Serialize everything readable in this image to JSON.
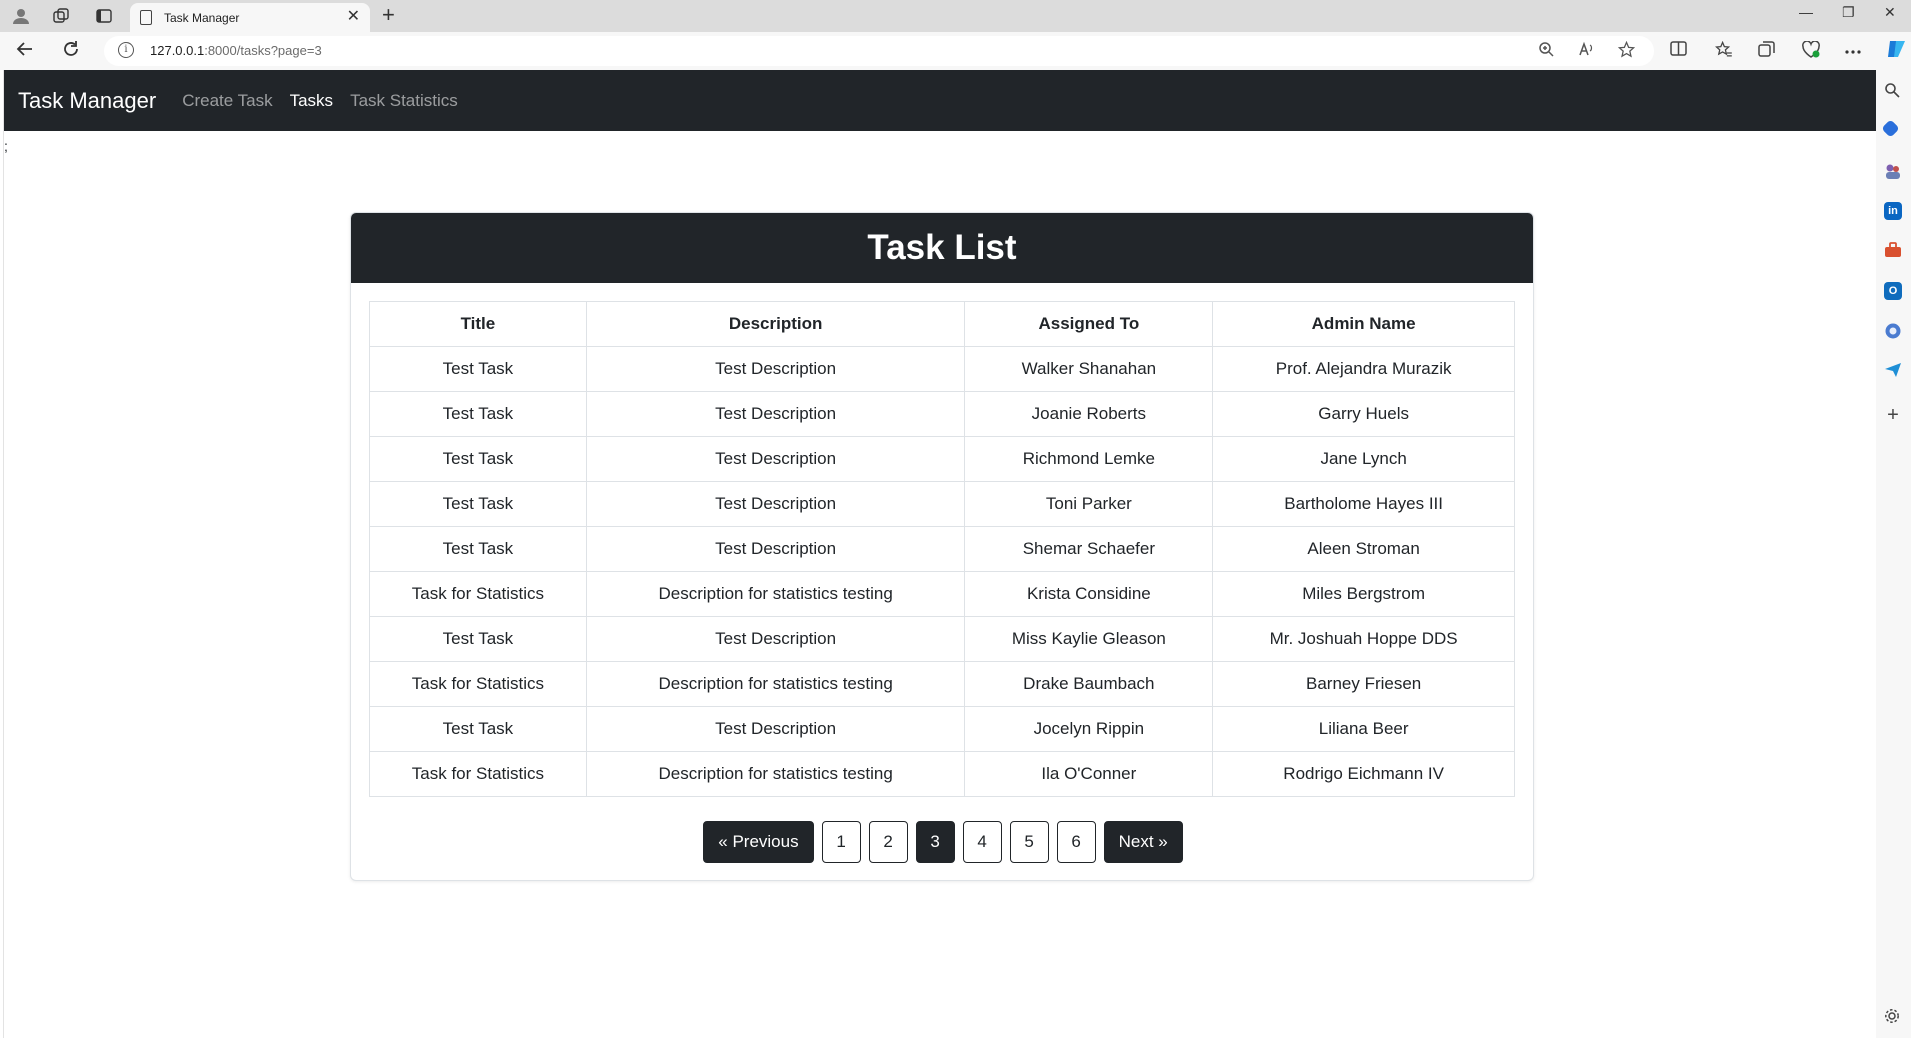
{
  "browser": {
    "tab_title": "Task Manager",
    "url_host": "127.0.0.1",
    "url_rest": ":8000/tasks?page=3",
    "new_tab_glyph": "+",
    "tab_close_glyph": "✕",
    "minimize_glyph": "—",
    "restore_glyph": "❐",
    "close_glyph": "✕"
  },
  "navbar": {
    "brand": "Task Manager",
    "links": [
      {
        "label": "Create Task",
        "active": false
      },
      {
        "label": "Tasks",
        "active": true
      },
      {
        "label": "Task Statistics",
        "active": false
      }
    ]
  },
  "stray_text": ";",
  "card": {
    "title": "Task List"
  },
  "table": {
    "headers": [
      "Title",
      "Description",
      "Assigned To",
      "Admin Name"
    ],
    "rows": [
      [
        "Test Task",
        "Test Description",
        "Walker Shanahan",
        "Prof. Alejandra Murazik"
      ],
      [
        "Test Task",
        "Test Description",
        "Joanie Roberts",
        "Garry Huels"
      ],
      [
        "Test Task",
        "Test Description",
        "Richmond Lemke",
        "Jane Lynch"
      ],
      [
        "Test Task",
        "Test Description",
        "Toni Parker",
        "Bartholome Hayes III"
      ],
      [
        "Test Task",
        "Test Description",
        "Shemar Schaefer",
        "Aleen Stroman"
      ],
      [
        "Task for Statistics",
        "Description for statistics testing",
        "Krista Considine",
        "Miles Bergstrom"
      ],
      [
        "Test Task",
        "Test Description",
        "Miss Kaylie Gleason",
        "Mr. Joshuah Hoppe DDS"
      ],
      [
        "Task for Statistics",
        "Description for statistics testing",
        "Drake Baumbach",
        "Barney Friesen"
      ],
      [
        "Test Task",
        "Test Description",
        "Jocelyn Rippin",
        "Liliana Beer"
      ],
      [
        "Task for Statistics",
        "Description for statistics testing",
        "Ila O'Conner",
        "Rodrigo Eichmann IV"
      ]
    ]
  },
  "pagination": {
    "previous_label": "« Previous",
    "next_label": "Next »",
    "pages": [
      "1",
      "2",
      "3",
      "4",
      "5",
      "6"
    ],
    "current": "3"
  },
  "colors": {
    "navbar_bg": "#212529",
    "link_active": "#ffffff",
    "link_inactive": "rgba(255,255,255,0.55)",
    "border": "#dee2e6"
  }
}
